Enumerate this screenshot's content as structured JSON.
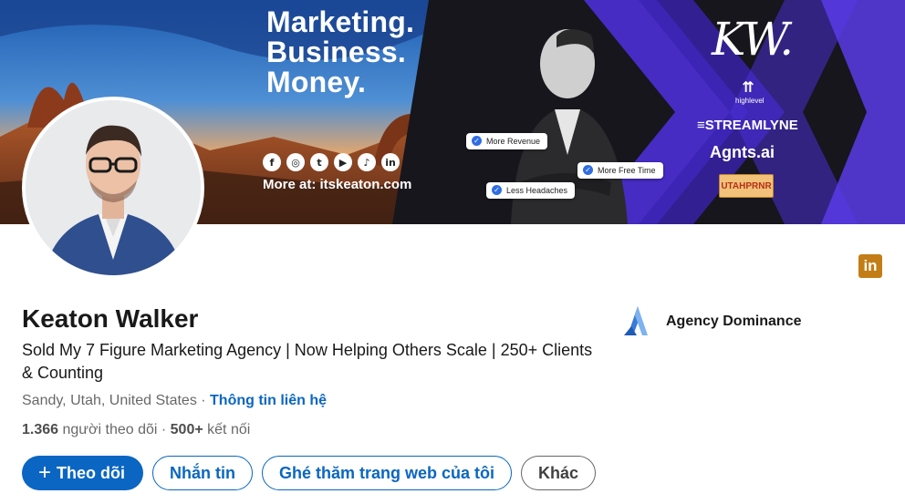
{
  "banner": {
    "headline": [
      "Marketing.",
      "Business.",
      "Money."
    ],
    "social_icons": [
      "facebook-icon",
      "instagram-icon",
      "twitter-icon",
      "youtube-icon",
      "tiktok-icon",
      "linkedin-icon"
    ],
    "social_glyphs": [
      "f",
      "◎",
      "t",
      "▶",
      "♪",
      "in"
    ],
    "more_at": "More at: itskeaton.com",
    "pills": [
      "More Revenue",
      "More Free Time",
      "Less Headaches"
    ],
    "brand_kw": "KW.",
    "brand_highlevel": "highlevel",
    "brand_streamlyne": "≡STREAMLYNE",
    "brand_agnts": "Agnts.ai",
    "brand_utahprnr": "UTAHPRNR"
  },
  "profile": {
    "name": "Keaton Walker",
    "tagline": "Sold My 7 Figure Marketing Agency | Now Helping Others Scale | 250+ Clients & Counting",
    "location": "Sandy, Utah, United States",
    "separator": " · ",
    "contact_info": "Thông tin liên hệ",
    "followers": "1.366",
    "followers_label": " người theo dõi",
    "connections": "500+",
    "connections_label": " kết nối",
    "stats_separator": " · "
  },
  "company": {
    "name": "Agency Dominance"
  },
  "linkedin_badge": "in",
  "actions": {
    "follow": "Theo dõi",
    "message": "Nhắn tin",
    "website": "Ghé thăm trang web của tôi",
    "more": "Khác"
  },
  "colors": {
    "brand_blue": "#0a66c2",
    "linkedin_badge_bg": "#c37d16",
    "banner_purple": "#4b2fd6"
  }
}
